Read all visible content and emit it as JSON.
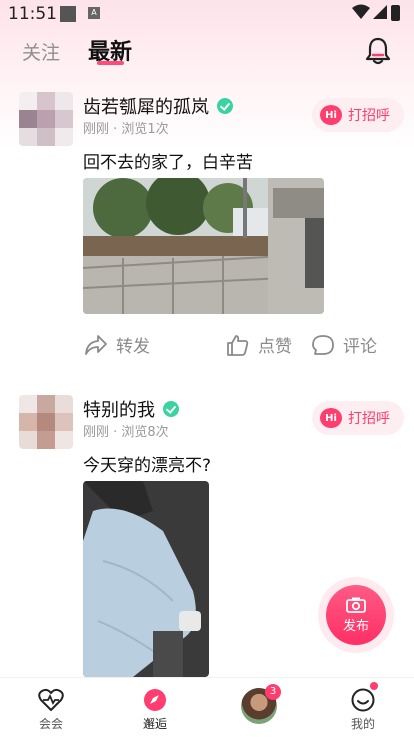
{
  "status_bar": {
    "time": "11:51",
    "badge_char": "A"
  },
  "header": {
    "tab_follow": "关注",
    "tab_latest": "最新"
  },
  "posts": [
    {
      "username": "齿若瓠犀的孤岚",
      "meta": "刚刚 · 浏览1次",
      "greet": "打招呼",
      "hi": "Hi",
      "text": "回不去的家了，白辛苦",
      "actions": {
        "share": "转发",
        "like": "点赞",
        "comment": "评论"
      }
    },
    {
      "username": "特别的我",
      "meta": "刚刚 · 浏览8次",
      "greet": "打招呼",
      "hi": "Hi",
      "text": "今天穿的漂亮不?"
    }
  ],
  "fab": {
    "label": "发布"
  },
  "bottom_nav": {
    "items": [
      {
        "label": "会会"
      },
      {
        "label": "邂逅"
      },
      {
        "label": "",
        "badge": "3"
      },
      {
        "label": "我的"
      }
    ]
  },
  "colors": {
    "accent": "#ff3d6e",
    "verify": "#3ad3a0"
  }
}
